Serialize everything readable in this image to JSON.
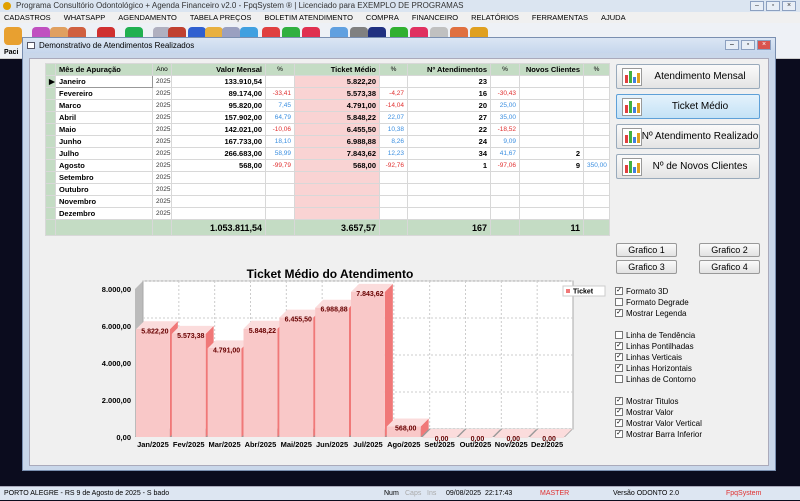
{
  "app": {
    "title": "Programa Consultório Odontológico + Agenda Financeiro v2.0 - FpqSystem ® | Licenciado para  EXEMPLO DE PROGRAMAS",
    "menu": [
      "CADASTROS",
      "WHATSAPP",
      "AGENDAMENTO",
      "TABELA PREÇOS",
      "BOLETIM ATENDIMENTO",
      "COMPRA",
      "FINANCEIRO",
      "RELATÓRIOS",
      "FERRAMENTAS",
      "AJUDA"
    ],
    "toolbar_label": "Paci"
  },
  "dialog": {
    "title": "Demonstrativo de Atendimentos Realizados"
  },
  "table": {
    "headers": [
      "Mês de Apuração",
      "Ano",
      "Valor Mensal",
      "%",
      "Ticket Médio",
      "%",
      "Nº Atendimentos",
      "%",
      "Novos Clientes",
      "%"
    ],
    "rows": [
      [
        "Janeiro",
        "2025",
        "133.910,54",
        "",
        "5.822,20",
        "",
        "23",
        "",
        "",
        ""
      ],
      [
        "Fevereiro",
        "2025",
        "89.174,00",
        "-33,41",
        "5.573,38",
        "-4,27",
        "16",
        "-30,43",
        "",
        ""
      ],
      [
        "Marco",
        "2025",
        "95.820,00",
        "7,45",
        "4.791,00",
        "-14,04",
        "20",
        "25,00",
        "",
        ""
      ],
      [
        "Abril",
        "2025",
        "157.902,00",
        "64,79",
        "5.848,22",
        "22,07",
        "27",
        "35,00",
        "",
        ""
      ],
      [
        "Maio",
        "2025",
        "142.021,00",
        "-10,06",
        "6.455,50",
        "10,38",
        "22",
        "-18,52",
        "",
        ""
      ],
      [
        "Junho",
        "2025",
        "167.733,00",
        "18,10",
        "6.988,88",
        "8,26",
        "24",
        "9,09",
        "",
        ""
      ],
      [
        "Julho",
        "2025",
        "266.683,00",
        "58,99",
        "7.843,62",
        "12,23",
        "34",
        "41,67",
        "2",
        ""
      ],
      [
        "Agosto",
        "2025",
        "568,00",
        "-99,79",
        "568,00",
        "-92,76",
        "1",
        "-97,06",
        "9",
        "350,00"
      ],
      [
        "Setembro",
        "2025",
        "",
        "",
        "",
        "",
        "",
        "",
        "",
        ""
      ],
      [
        "Outubro",
        "2025",
        "",
        "",
        "",
        "",
        "",
        "",
        "",
        ""
      ],
      [
        "Novembro",
        "2025",
        "",
        "",
        "",
        "",
        "",
        "",
        "",
        ""
      ],
      [
        "Dezembro",
        "2025",
        "",
        "",
        "",
        "",
        "",
        "",
        "",
        ""
      ]
    ],
    "totals": {
      "valor": "1.053.811,54",
      "ticket": "3.657,57",
      "atendimentos": "167",
      "novos": "11"
    }
  },
  "side_buttons": [
    "Atendimento Mensal",
    "Ticket Médio",
    "Nº Atendimento Realizado",
    "Nº de Novos Clientes"
  ],
  "graph_buttons": [
    "Grafico 1",
    "Grafico 2",
    "Grafico 3",
    "Grafico 4"
  ],
  "options": [
    {
      "label": "Formato 3D",
      "checked": true
    },
    {
      "label": "Formato Degrade",
      "checked": false
    },
    {
      "label": "Mostrar Legenda",
      "checked": true
    },
    {
      "label": "Linha de Tendência",
      "checked": false
    },
    {
      "label": "Linhas Pontilhadas",
      "checked": true
    },
    {
      "label": "Linhas Verticais",
      "checked": true
    },
    {
      "label": "Linhas Horizontais",
      "checked": true
    },
    {
      "label": "Linhas de Contorno",
      "checked": false
    },
    {
      "label": "Mostrar Titulos",
      "checked": true
    },
    {
      "label": "Mostrar Valor",
      "checked": true
    },
    {
      "label": "Mostrar Valor Vertical",
      "checked": true
    },
    {
      "label": "Mostrar Barra Inferior",
      "checked": true
    }
  ],
  "chart_data": {
    "type": "bar",
    "title": "Ticket Médio do Atendimento",
    "legend": [
      "Ticket"
    ],
    "legend_position": "top-right",
    "three_d": true,
    "grid": true,
    "color": "#f9c8c8",
    "categories": [
      "Jan/2025",
      "Fev/2025",
      "Mar/2025",
      "Abr/2025",
      "Mai/2025",
      "Jun/2025",
      "Jul/2025",
      "Ago/2025",
      "Set/2025",
      "Out/2025",
      "Nov/2025",
      "Dez/2025"
    ],
    "values": [
      5822.2,
      5573.38,
      4791.0,
      5848.22,
      6455.5,
      6988.88,
      7843.62,
      568.0,
      0,
      0,
      0,
      0
    ],
    "labels": [
      "5.822,20",
      "5.573,38",
      "4.791,00",
      "5.848,22",
      "6.455,50",
      "6.988,88",
      "7.843,62",
      "568,00",
      "0,00",
      "0,00",
      "0,00",
      "0,00"
    ],
    "yticks": [
      "0,00",
      "2.000,00",
      "4.000,00",
      "6.000,00",
      "8.000,00"
    ],
    "ylim": [
      0,
      8000
    ]
  },
  "status": {
    "location": "PORTO ALEGRE - RS  9 de Agosto de 2025 - S bado",
    "num": "Num",
    "caps": "Caps",
    "ins": "Ins",
    "date": "09/08/2025",
    "time": "22:17:43",
    "user": "MASTER",
    "version": "Versão ODONTO 2.0",
    "brand": "FpqSystem"
  }
}
